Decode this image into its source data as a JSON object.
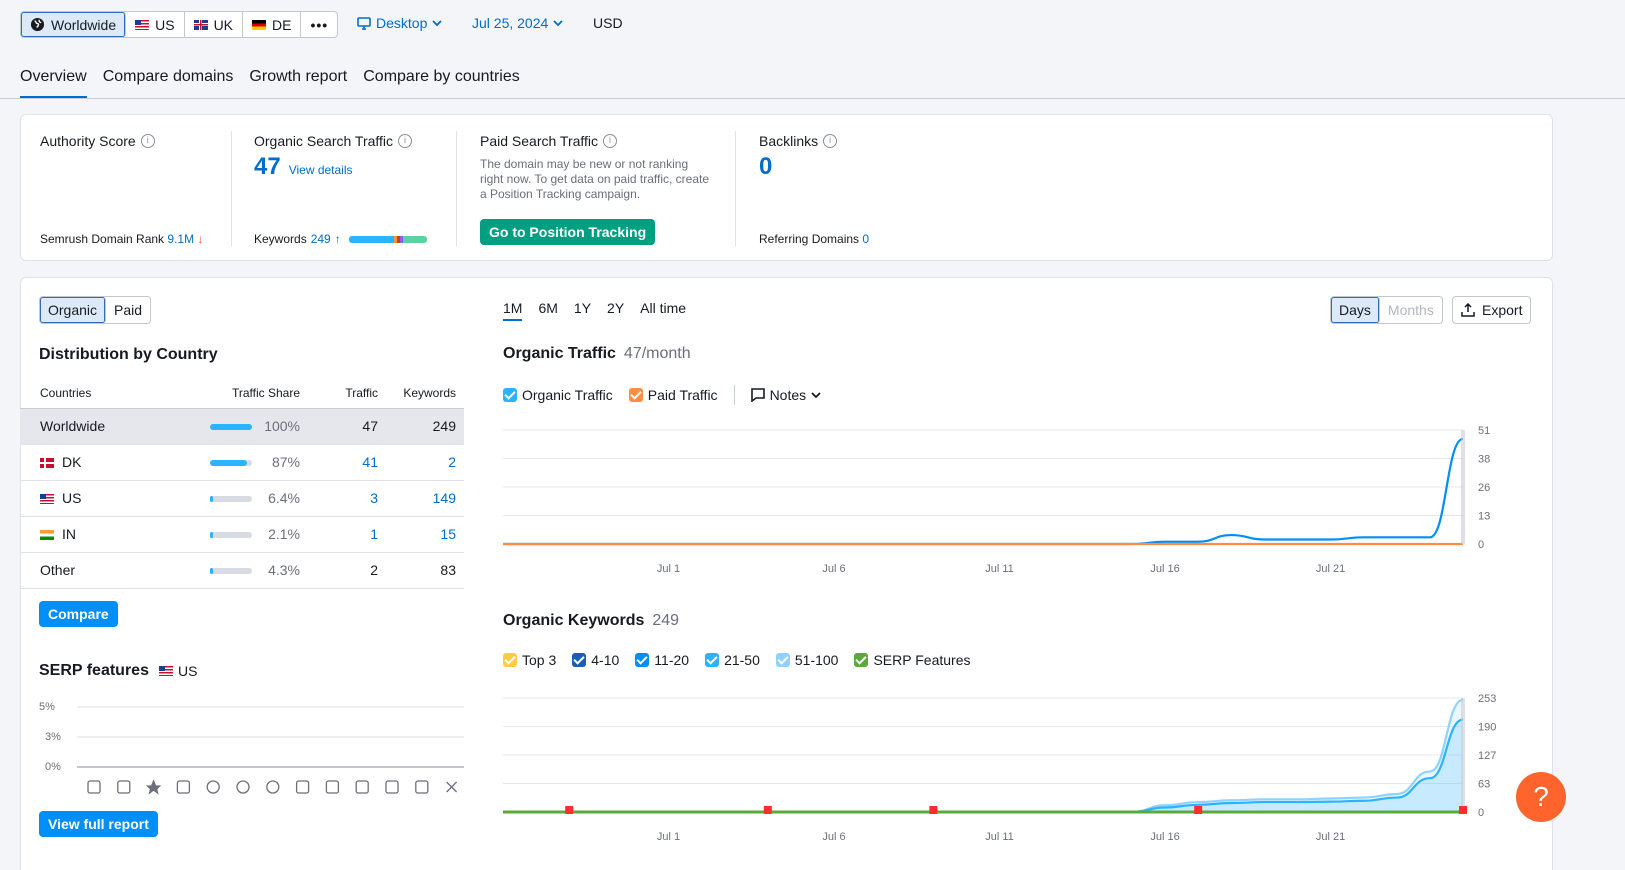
{
  "databases": [
    {
      "label": "Worldwide",
      "icon": "globe-icon",
      "active": true
    },
    {
      "label": "US",
      "icon": "flag-us-icon"
    },
    {
      "label": "UK",
      "icon": "flag-uk-icon"
    },
    {
      "label": "DE",
      "icon": "flag-de-icon"
    }
  ],
  "device": "Desktop",
  "date": "Jul 25, 2024",
  "currency": "USD",
  "tabs": [
    "Overview",
    "Compare domains",
    "Growth report",
    "Compare by countries"
  ],
  "kpis": {
    "authority": {
      "title": "Authority Score",
      "rank_label": "Semrush Domain Rank",
      "rank_value": "9.1M"
    },
    "organic": {
      "title": "Organic Search Traffic",
      "value": "47",
      "link": "View details",
      "keywords_label": "Keywords",
      "keywords_value": "249"
    },
    "paid": {
      "title": "Paid Search Traffic",
      "description": "The domain may be new or not ranking right now. To get data on paid traffic, create a Position Tracking campaign.",
      "button": "Go to Position Tracking"
    },
    "backlinks": {
      "title": "Backlinks",
      "value": "0",
      "ref_label": "Referring Domains",
      "ref_value": "0"
    }
  },
  "left": {
    "toggle": [
      "Organic",
      "Paid"
    ],
    "dist_title": "Distribution by Country",
    "columns": [
      "Countries",
      "Traffic Share",
      "Traffic",
      "Keywords"
    ],
    "rows": [
      {
        "country": "Worldwide",
        "flag": "",
        "share": "100%",
        "share_frac": 1.0,
        "traffic": "47",
        "keywords": "249"
      },
      {
        "country": "DK",
        "flag": "flag-dk",
        "share": "87%",
        "share_frac": 0.87,
        "traffic": "41",
        "keywords": "2"
      },
      {
        "country": "US",
        "flag": "flag-us",
        "share": "6.4%",
        "share_frac": 0.064,
        "traffic": "3",
        "keywords": "149"
      },
      {
        "country": "IN",
        "flag": "flag-in",
        "share": "2.1%",
        "share_frac": 0.021,
        "traffic": "1",
        "keywords": "15"
      },
      {
        "country": "Other",
        "flag": "",
        "share": "4.3%",
        "share_frac": 0.043,
        "traffic": "2",
        "keywords": "83"
      }
    ],
    "compare_button": "Compare",
    "serp_title": "SERP features",
    "serp_db": "US",
    "serp_y": [
      "5%",
      "3%",
      "0%"
    ],
    "view_full": "View full report"
  },
  "right": {
    "periods": [
      "1M",
      "6M",
      "1Y",
      "2Y",
      "All time"
    ],
    "granularity": [
      "Days",
      "Months"
    ],
    "export": "Export",
    "traffic_title": "Organic Traffic",
    "traffic_value": "47/month",
    "traffic_legend": [
      "Organic Traffic",
      "Paid Traffic"
    ],
    "notes": "Notes",
    "keywords_title": "Organic Keywords",
    "keywords_value": "249",
    "keywords_legend": [
      "Top 3",
      "4-10",
      "11-20",
      "21-50",
      "51-100",
      "SERP Features"
    ]
  },
  "colors": {
    "accent": "#006dca",
    "organic": "#008ff8",
    "paid": "#ff8c43",
    "green": "#009f81",
    "serp": "#59a93b"
  },
  "chart_data": [
    {
      "type": "line",
      "title": "Organic Traffic",
      "x": [
        "Jun 26",
        "Jun 27",
        "Jun 28",
        "Jun 29",
        "Jun 30",
        "Jul 1",
        "Jul 2",
        "Jul 3",
        "Jul 4",
        "Jul 5",
        "Jul 6",
        "Jul 7",
        "Jul 8",
        "Jul 9",
        "Jul 10",
        "Jul 11",
        "Jul 12",
        "Jul 13",
        "Jul 14",
        "Jul 15",
        "Jul 16",
        "Jul 17",
        "Jul 18",
        "Jul 19",
        "Jul 20",
        "Jul 21",
        "Jul 22",
        "Jul 23",
        "Jul 24",
        "Jul 25"
      ],
      "xticks": [
        "Jul 1",
        "Jul 6",
        "Jul 11",
        "Jul 16",
        "Jul 21"
      ],
      "yticks": [
        "0",
        "13",
        "26",
        "38",
        "51"
      ],
      "ylim": [
        0,
        51
      ],
      "series": [
        {
          "name": "Organic Traffic",
          "color": "#008ff8",
          "values": [
            0,
            0,
            0,
            0,
            0,
            0,
            0,
            0,
            0,
            0,
            0,
            0,
            0,
            0,
            0,
            0,
            0,
            0,
            0,
            0,
            1,
            1,
            4,
            2,
            2,
            2,
            3,
            3,
            3,
            47
          ]
        },
        {
          "name": "Paid Traffic",
          "color": "#ff8c43",
          "values": [
            0,
            0,
            0,
            0,
            0,
            0,
            0,
            0,
            0,
            0,
            0,
            0,
            0,
            0,
            0,
            0,
            0,
            0,
            0,
            0,
            0,
            0,
            0,
            0,
            0,
            0,
            0,
            0,
            0,
            0
          ]
        }
      ]
    },
    {
      "type": "area",
      "title": "Organic Keywords",
      "x": [
        "Jun 26",
        "Jun 27",
        "Jun 28",
        "Jun 29",
        "Jun 30",
        "Jul 1",
        "Jul 2",
        "Jul 3",
        "Jul 4",
        "Jul 5",
        "Jul 6",
        "Jul 7",
        "Jul 8",
        "Jul 9",
        "Jul 10",
        "Jul 11",
        "Jul 12",
        "Jul 13",
        "Jul 14",
        "Jul 15",
        "Jul 16",
        "Jul 17",
        "Jul 18",
        "Jul 19",
        "Jul 20",
        "Jul 21",
        "Jul 22",
        "Jul 23",
        "Jul 24",
        "Jul 25"
      ],
      "xticks": [
        "Jul 1",
        "Jul 6",
        "Jul 11",
        "Jul 16",
        "Jul 21"
      ],
      "yticks": [
        "0",
        "63",
        "127",
        "190",
        "253"
      ],
      "ylim": [
        0,
        253
      ],
      "series": [
        {
          "name": "51-100",
          "color": "#8ed3ff",
          "values": [
            0,
            0,
            0,
            0,
            0,
            0,
            0,
            0,
            0,
            0,
            0,
            0,
            0,
            0,
            0,
            0,
            0,
            0,
            0,
            0,
            15,
            22,
            26,
            28,
            28,
            30,
            32,
            40,
            90,
            249
          ]
        },
        {
          "name": "21-50",
          "color": "#2bb3ff",
          "values": [
            0,
            0,
            0,
            0,
            0,
            0,
            0,
            0,
            0,
            0,
            0,
            0,
            0,
            0,
            0,
            0,
            0,
            0,
            0,
            0,
            10,
            16,
            20,
            22,
            22,
            23,
            25,
            32,
            75,
            205
          ]
        },
        {
          "name": "SERP Features",
          "color": "#59a93b",
          "values": [
            0,
            0,
            0,
            0,
            0,
            0,
            0,
            0,
            0,
            0,
            0,
            0,
            0,
            0,
            0,
            0,
            0,
            0,
            0,
            0,
            0,
            0,
            0,
            0,
            0,
            0,
            0,
            0,
            0,
            0
          ]
        }
      ],
      "markers_x": [
        2,
        8,
        13,
        21,
        29
      ]
    },
    {
      "type": "line",
      "title": "SERP features",
      "yticks": [
        "5%",
        "3%",
        "0%"
      ]
    }
  ]
}
